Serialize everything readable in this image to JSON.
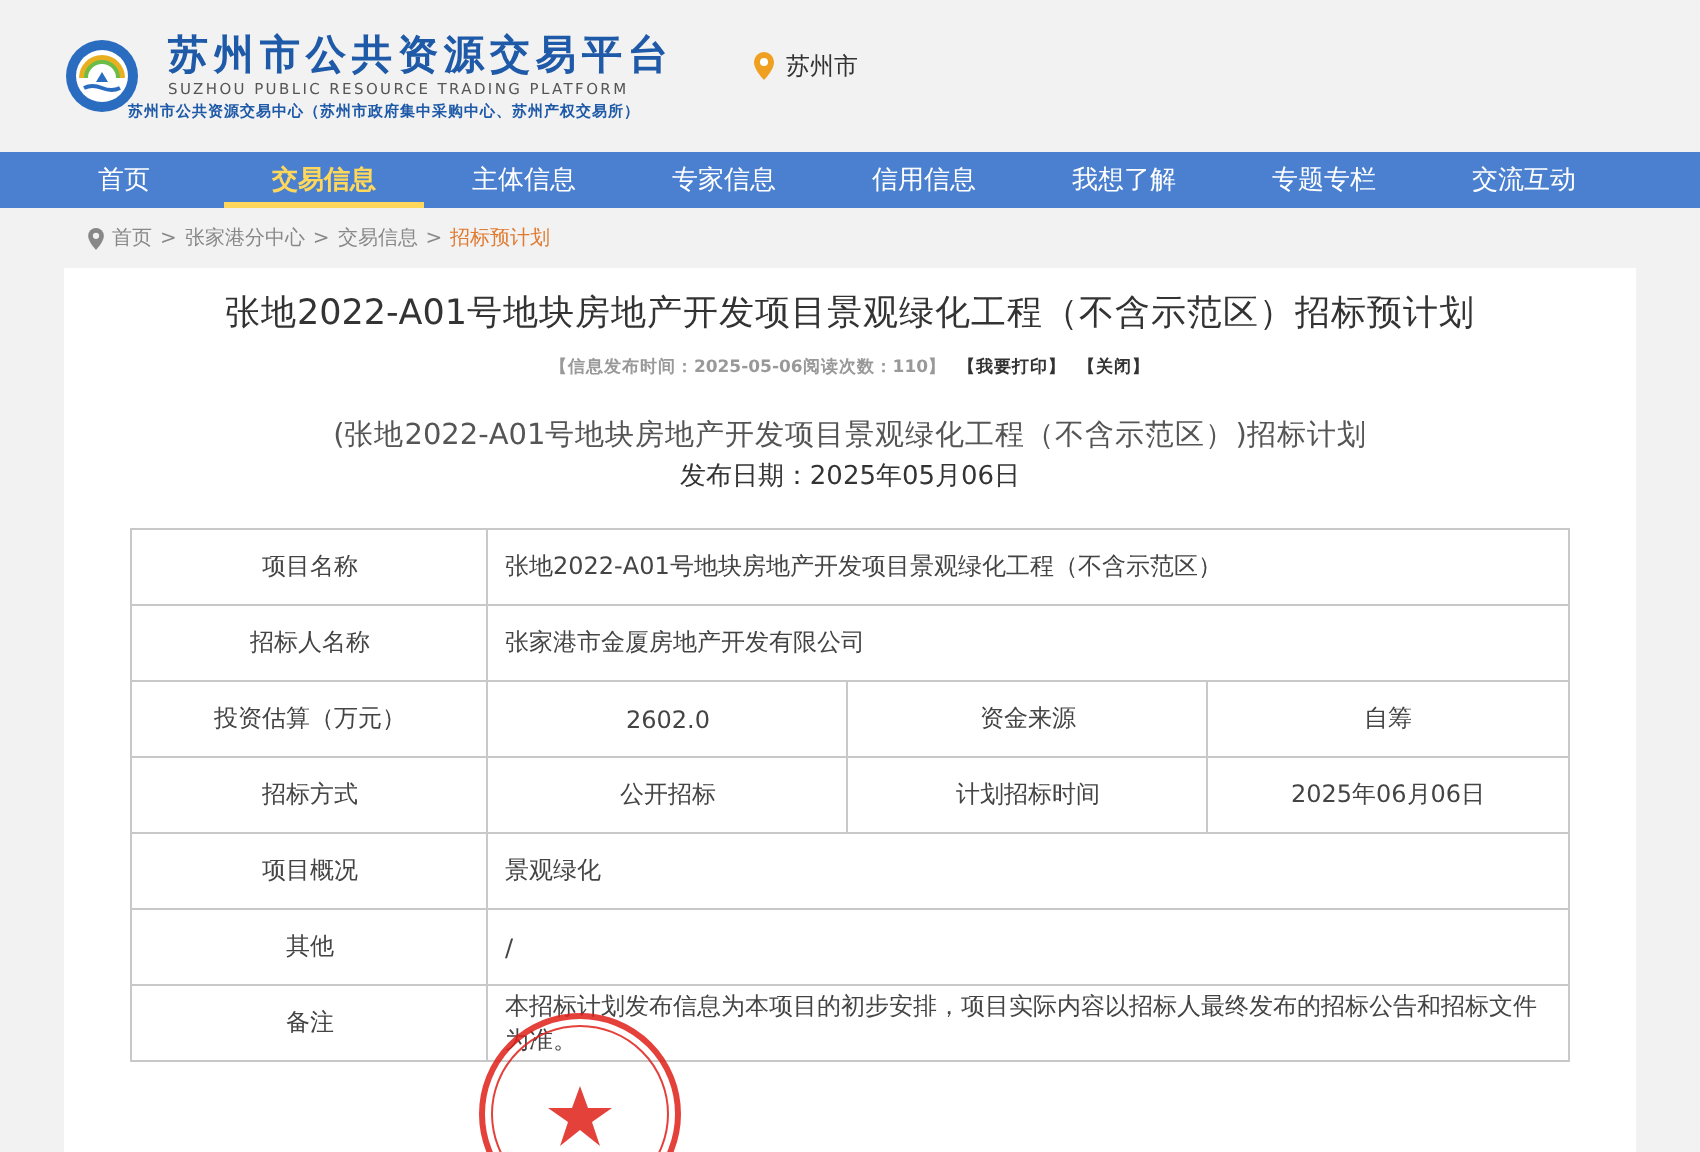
{
  "header": {
    "logo_title": "苏州市公共资源交易平台",
    "logo_subtitle": "SUZHOU PUBLIC RESOURCE TRADING PLATFORM",
    "logo_caption": "苏州市公共资源交易中心（苏州市政府集中采购中心、苏州产权交易所）",
    "location": "苏州市"
  },
  "nav": [
    {
      "label": "首页",
      "selected": false
    },
    {
      "label": "交易信息",
      "selected": true
    },
    {
      "label": "主体信息",
      "selected": false
    },
    {
      "label": "专家信息",
      "selected": false
    },
    {
      "label": "信用信息",
      "selected": false
    },
    {
      "label": "我想了解",
      "selected": false
    },
    {
      "label": "专题专栏",
      "selected": false
    },
    {
      "label": "交流互动",
      "selected": false
    }
  ],
  "breadcrumb": [
    {
      "label": "首页",
      "current": false
    },
    {
      "label": "张家港分中心",
      "current": false
    },
    {
      "label": "交易信息",
      "current": false
    },
    {
      "label": "招标预计划",
      "current": true
    }
  ],
  "breadcrumb_separator": ">",
  "article": {
    "title": "张地2022-A01号地块房地产开发项目景观绿化工程（不含示范区）招标预计划",
    "meta": "【信息发布时间：2025-05-06阅读次数：110】",
    "actions": [
      "【我要打印】",
      "【关闭】"
    ],
    "subtitle": "(张地2022-A01号地块房地产开发项目景观绿化工程（不含示范区）)招标计划",
    "publish_date": "发布日期：2025年05月06日"
  },
  "table": {
    "rows": [
      {
        "kind": "wide",
        "label": "项目名称",
        "value": "张地2022-A01号地块房地产开发项目景观绿化工程（不含示范区）"
      },
      {
        "kind": "wide",
        "label": "招标人名称",
        "value": "张家港市金厦房地产开发有限公司"
      },
      {
        "kind": "split",
        "cells": [
          "投资估算（万元）",
          "2602.0",
          "资金来源",
          "自筹"
        ]
      },
      {
        "kind": "split",
        "cells": [
          "招标方式",
          "公开招标",
          "计划招标时间",
          "2025年06月06日"
        ]
      },
      {
        "kind": "wide",
        "label": "项目概况",
        "value": "景观绿化"
      },
      {
        "kind": "wide",
        "label": "其他",
        "value": "/"
      },
      {
        "kind": "wide",
        "label": "备注",
        "value": "本招标计划发布信息为本项目的初步安排，项目实际内容以招标人最终发布的招标公告和招标文件为准。",
        "stamped": true
      }
    ]
  }
}
